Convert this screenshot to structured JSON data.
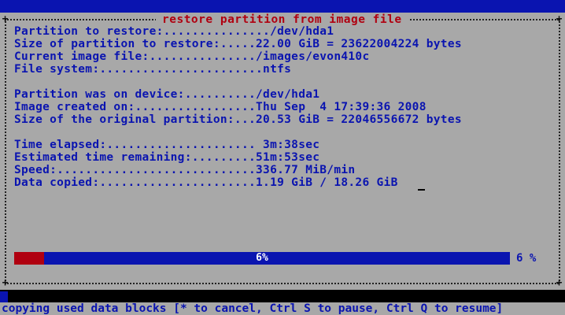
{
  "dialog": {
    "title": "restore partition from image file"
  },
  "rows": [
    "Partition to restore:.............../dev/hda1",
    "Size of partition to restore:.....22.00 GiB = 23622004224 bytes",
    "Current image file:.............../images/evon410c",
    "File system:.......................ntfs",
    "",
    "Partition was on device:........../dev/hda1",
    "Image created on:.................Thu Sep  4 17:39:36 2008",
    "Size of the original partition:...20.53 GiB = 22046556672 bytes",
    "",
    "Time elapsed:..................... 3m:38sec",
    "Estimated time remaining:.........51m:53sec",
    "Speed:............................336.77 MiB/min",
    "Data copied:......................1.19 GiB / 18.26 GiB"
  ],
  "progress": {
    "fraction": 0.06,
    "center_label": "6%",
    "right_label": "6 %"
  },
  "status_line": "copying used data blocks [* to cancel, Ctrl S to pause, Ctrl Q to resume]",
  "colors": {
    "background": "#a8a8a8",
    "text": "#0a14b0",
    "title": "#b00010",
    "progress_bar": "#0a14b0",
    "progress_fill": "#b00010"
  }
}
